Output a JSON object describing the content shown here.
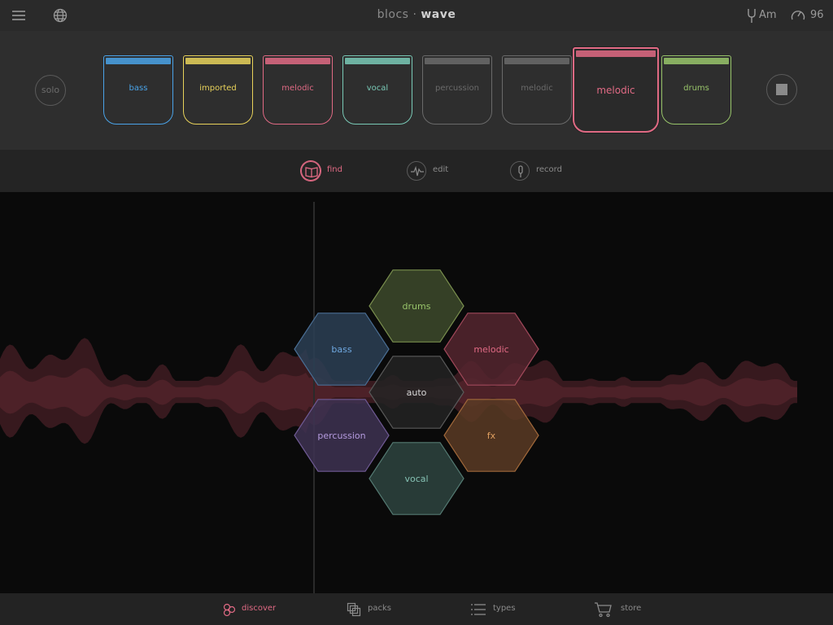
{
  "app": {
    "title_light": "blocs",
    "title_sep": "·",
    "title_bold": "wave",
    "key": "Am",
    "tempo": "96"
  },
  "icons": {
    "menu": "menu-icon",
    "globe": "globe-icon",
    "tuning_fork": "tuning-fork-icon",
    "tempo": "tempo-gauge-icon",
    "stop": "stop-icon",
    "find": "book-icon",
    "edit": "waveform-icon",
    "record": "microphone-icon",
    "discover": "hexagons-icon",
    "packs": "packs-icon",
    "types": "list-icon",
    "store": "cart-icon"
  },
  "blocs": {
    "solo_label": "solo",
    "items": [
      {
        "label": "bass",
        "color": "#4aa3e8"
      },
      {
        "label": "imported",
        "color": "#e8d25a"
      },
      {
        "label": "melodic",
        "color": "#e06a84"
      },
      {
        "label": "vocal",
        "color": "#79c9b6"
      },
      {
        "label": "percussion",
        "color": "#6a6a6a"
      },
      {
        "label": "melodic",
        "color": "#6a6a6a"
      },
      {
        "label": "melodic",
        "color": "#e06a84"
      },
      {
        "label": "drums",
        "color": "#98c46a"
      }
    ]
  },
  "modes": {
    "find": "find",
    "edit": "edit",
    "record": "record",
    "active": "find",
    "accent": "#e06a84"
  },
  "hexes": {
    "drums": "drums",
    "bass": "bass",
    "melodic": "melodic",
    "auto": "auto",
    "percussion": "percussion",
    "fx": "fx",
    "vocal": "vocal"
  },
  "nav": {
    "discover": "discover",
    "packs": "packs",
    "types": "types",
    "store": "store",
    "active": "discover"
  }
}
